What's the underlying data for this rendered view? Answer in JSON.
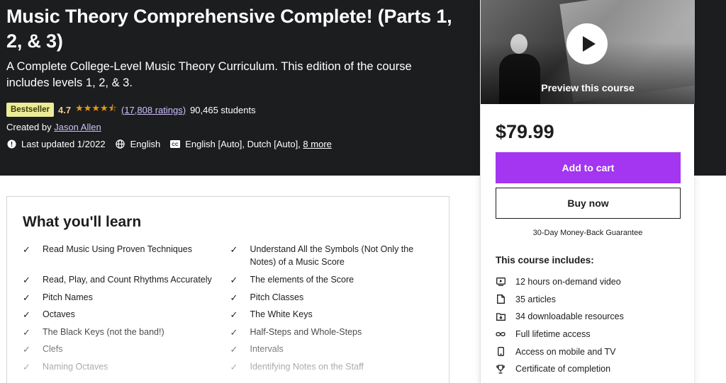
{
  "course": {
    "title": "Music Theory Comprehensive Complete! (Parts 1, 2, & 3)",
    "subtitle": "A Complete College-Level Music Theory Curriculum. This edition of the course includes levels 1, 2, & 3.",
    "badge": "Bestseller",
    "rating": "4.7",
    "stars": "★★★★⯪",
    "ratings_count": "(17,808 ratings)",
    "students": "90,465 students",
    "created_prefix": "Created by",
    "instructor": "Jason Allen",
    "last_updated": "Last updated 1/2022",
    "language": "English",
    "captions": "English [Auto], Dutch [Auto],",
    "captions_more": "8 more"
  },
  "card": {
    "preview_label": "Preview this course",
    "price": "$79.99",
    "add_to_cart": "Add to cart",
    "buy_now": "Buy now",
    "guarantee": "30-Day Money-Back Guarantee",
    "includes_title": "This course includes:",
    "includes": [
      {
        "icon": "video-icon",
        "label": "12 hours on-demand video"
      },
      {
        "icon": "article-icon",
        "label": "35 articles"
      },
      {
        "icon": "download-icon",
        "label": "34 downloadable resources"
      },
      {
        "icon": "infinity-icon",
        "label": "Full lifetime access"
      },
      {
        "icon": "mobile-icon",
        "label": "Access on mobile and TV"
      },
      {
        "icon": "trophy-icon",
        "label": "Certificate of completion"
      }
    ]
  },
  "learn": {
    "title": "What you'll learn",
    "rows": [
      [
        "Read Music Using Proven Techniques",
        "Understand All the Symbols (Not Only the Notes) of a Music Score"
      ],
      [
        "Read, Play, and Count Rhythms Accurately",
        "The elements of the Score"
      ],
      [
        "Pitch Names",
        "Pitch Classes"
      ],
      [
        "Octaves",
        "The White Keys"
      ],
      [
        "The Black Keys (not the band!)",
        "Half-Steps and Whole-Steps"
      ],
      [
        "Clefs",
        "Intervals"
      ],
      [
        "Naming Octaves",
        "Identifying Notes on the Staff"
      ]
    ]
  },
  "colors": {
    "banner": "#1c1d1f",
    "accent": "#a435f0",
    "badge_bg": "#eceb98",
    "star": "#e59819",
    "link": "#cec0fc"
  }
}
